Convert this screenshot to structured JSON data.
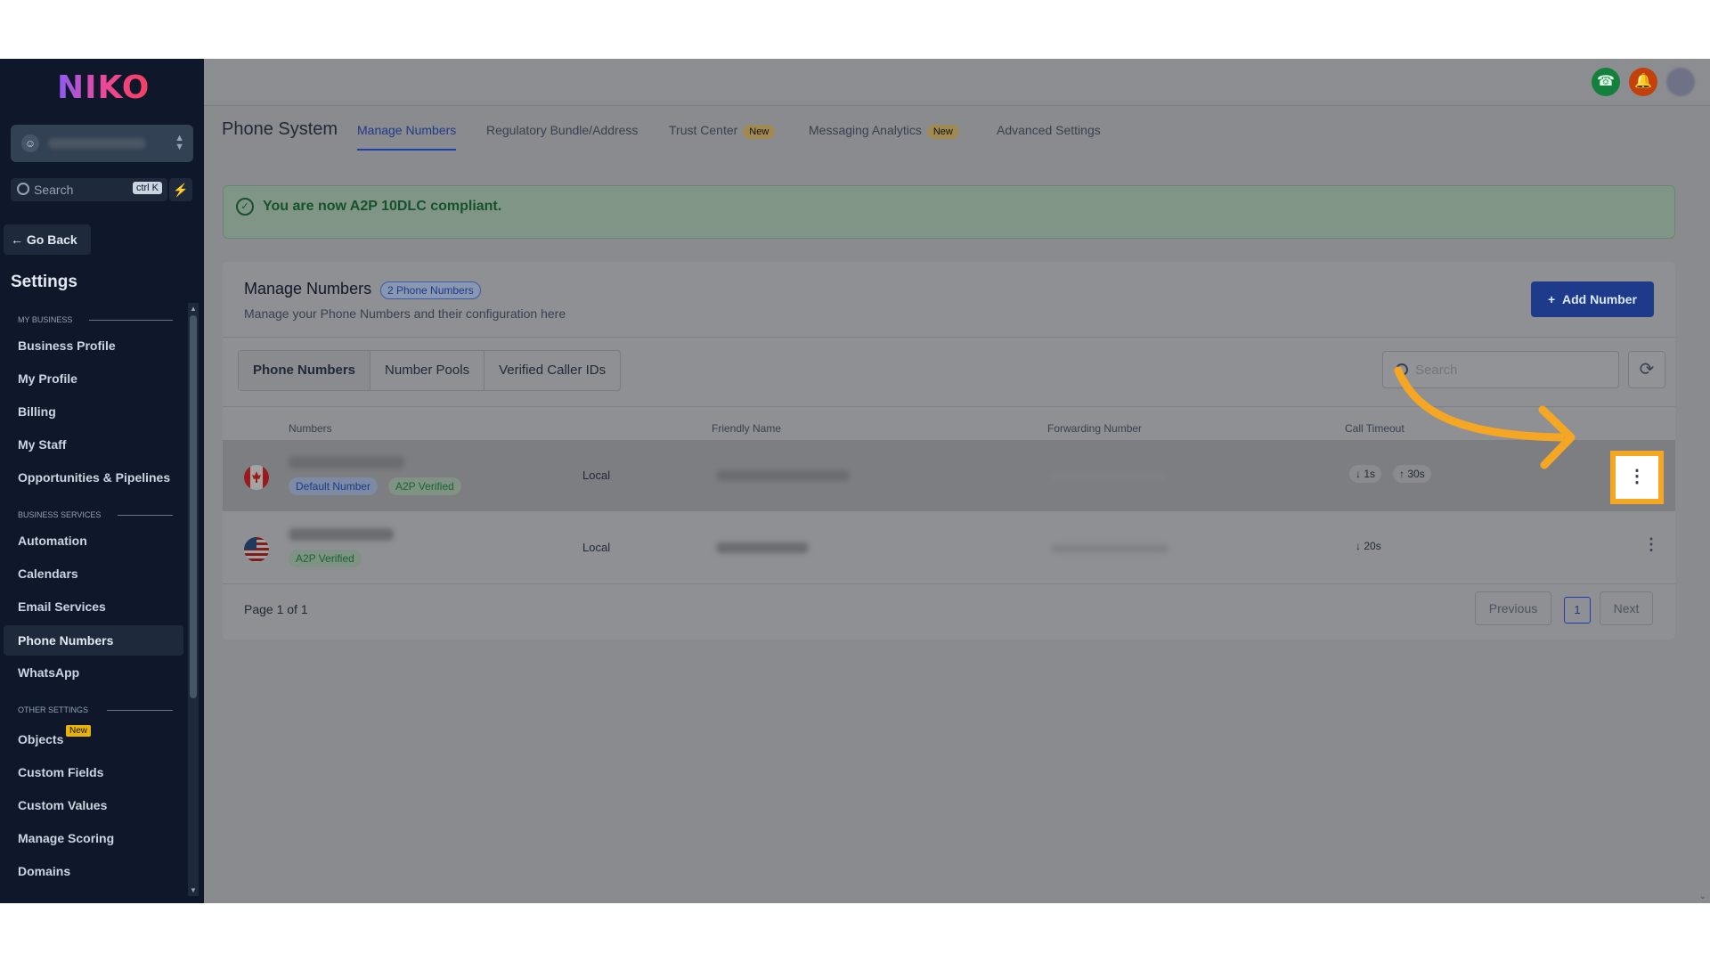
{
  "brand": {
    "logo": "NIKO",
    "accent": "#1e40af",
    "highlight": "#f5a623"
  },
  "sidebar": {
    "search_placeholder": "Search",
    "search_shortcut": "ctrl K",
    "go_back": "Go Back",
    "settings_title": "Settings",
    "sections": {
      "my_business": "MY BUSINESS",
      "business_services": "BUSINESS SERVICES",
      "other_settings": "OTHER SETTINGS"
    },
    "items": {
      "business_profile": "Business Profile",
      "my_profile": "My Profile",
      "billing": "Billing",
      "my_staff": "My Staff",
      "opportunities": "Opportunities & Pipelines",
      "automation": "Automation",
      "calendars": "Calendars",
      "email_services": "Email Services",
      "phone_numbers": "Phone Numbers",
      "whatsapp": "WhatsApp",
      "objects": "Objects",
      "objects_badge": "New",
      "custom_fields": "Custom Fields",
      "custom_values": "Custom Values",
      "manage_scoring": "Manage Scoring",
      "domains": "Domains"
    }
  },
  "header": {
    "page_title": "Phone System",
    "tabs": {
      "manage_numbers": "Manage Numbers",
      "regulatory": "Regulatory Bundle/Address",
      "trust_center": "Trust Center",
      "trust_center_badge": "New",
      "messaging_analytics": "Messaging Analytics",
      "messaging_analytics_badge": "New",
      "advanced_settings": "Advanced Settings"
    }
  },
  "alert": {
    "message": "You are now A2P 10DLC compliant."
  },
  "card": {
    "title": "Manage Numbers",
    "count_badge": "2 Phone Numbers",
    "subtitle": "Manage your Phone Numbers and their configuration here",
    "add_button": "Add Number",
    "segments": {
      "phone_numbers": "Phone Numbers",
      "number_pools": "Number Pools",
      "verified_caller_ids": "Verified Caller IDs"
    },
    "search_placeholder": "Search",
    "columns": {
      "numbers": "Numbers",
      "friendly_name": "Friendly Name",
      "forwarding_number": "Forwarding Number",
      "call_timeout": "Call Timeout"
    },
    "rows": [
      {
        "country": "Canada",
        "default_chip": "Default Number",
        "verified_chip": "A2P Verified",
        "type": "Local",
        "timeout_in": "1s",
        "timeout_out": "30s"
      },
      {
        "country": "United States",
        "verified_chip": "A2P Verified",
        "type": "Local",
        "timeout_in": "20s"
      }
    ],
    "pagination": {
      "label": "Page 1 of 1",
      "previous": "Previous",
      "current": "1",
      "next": "Next"
    }
  }
}
